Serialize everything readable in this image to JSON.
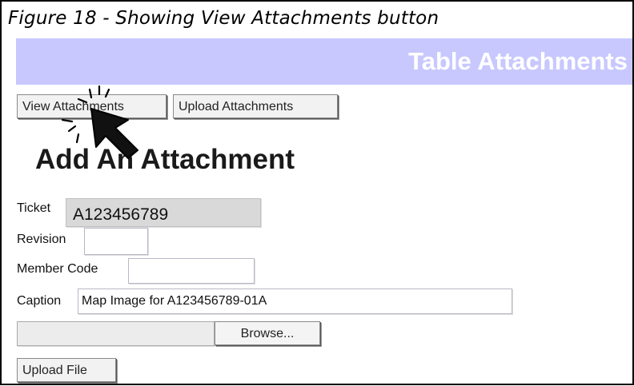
{
  "figure_caption": "Figure 18 - Showing View Attachments button",
  "header": {
    "title": "Table Attachments"
  },
  "toolbar": {
    "view_attachments_label": "View Attachments",
    "upload_attachments_label": "Upload Attachments"
  },
  "section": {
    "title": "Add An Attachment"
  },
  "form": {
    "ticket_label": "Ticket",
    "ticket_value": "A123456789",
    "revision_label": "Revision",
    "revision_value": "",
    "member_code_label": "Member Code",
    "member_code_value": "",
    "caption_label": "Caption",
    "caption_value": "Map Image for A123456789-01A",
    "file_value": "",
    "browse_label": "Browse...",
    "upload_file_label": "Upload File"
  },
  "icons": {
    "cursor": "mouse-pointer-arrow-click-icon"
  },
  "colors": {
    "header_bg": "#c8c8ff",
    "header_text": "#ffffff"
  }
}
